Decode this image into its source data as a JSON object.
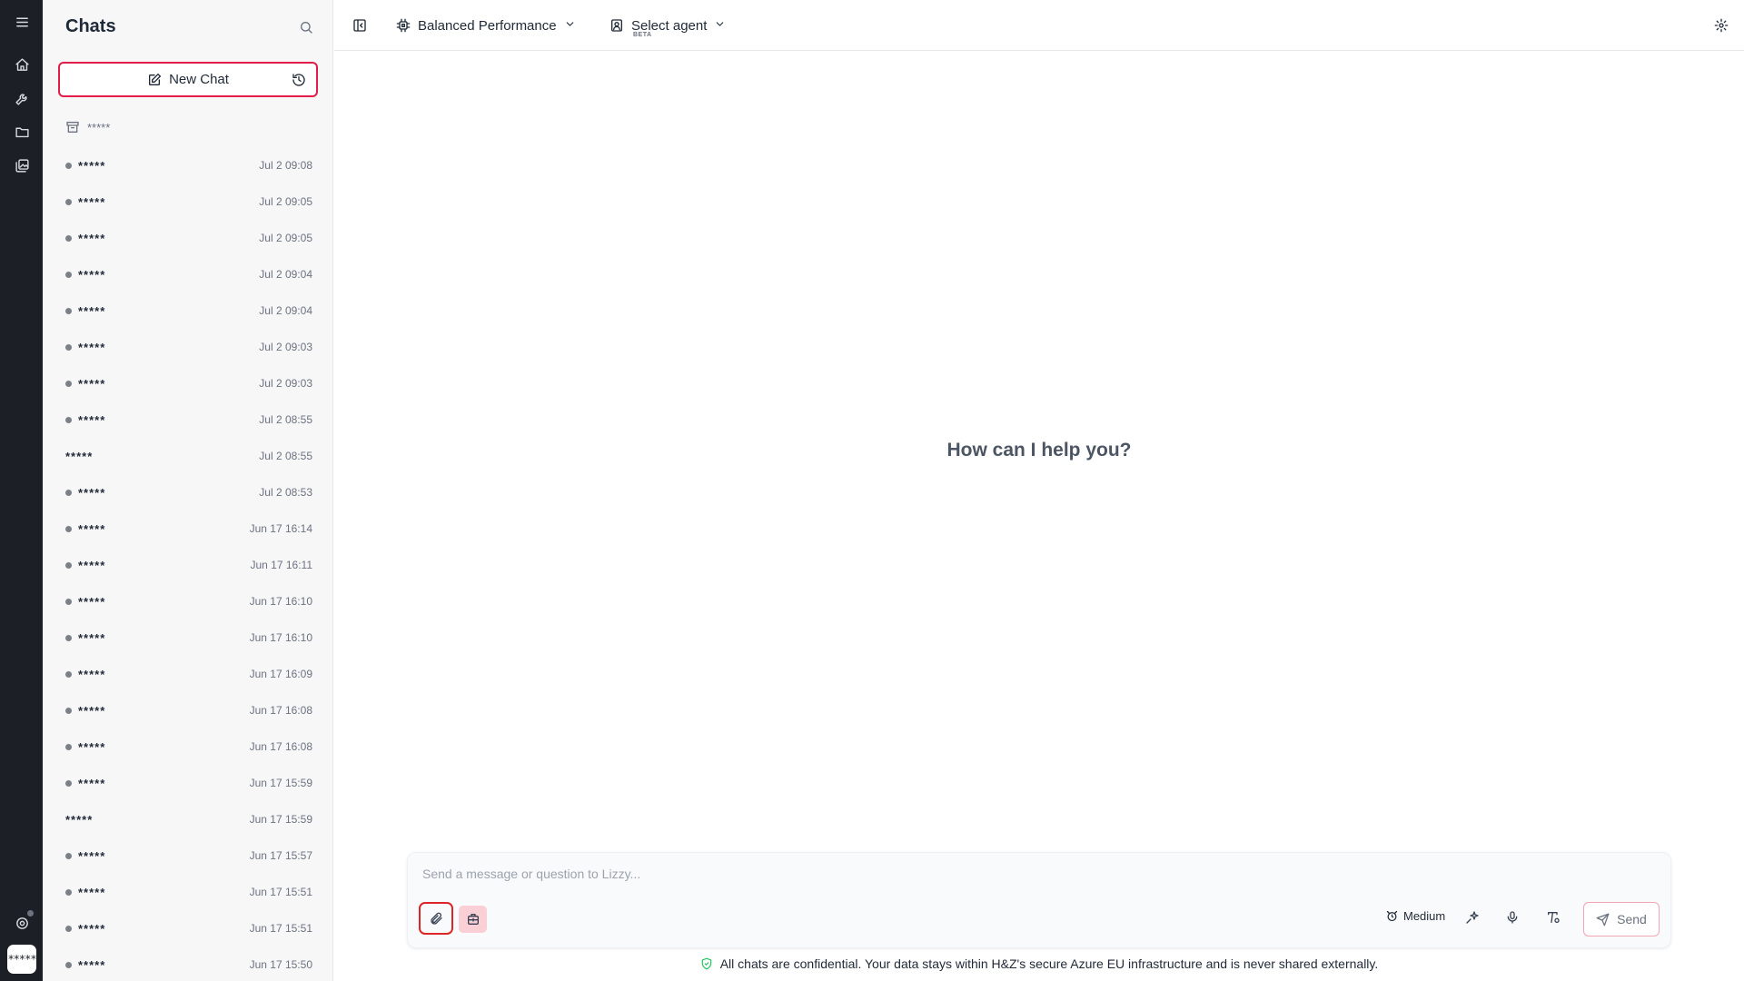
{
  "sidebar": {
    "title": "Chats",
    "new_chat_label": "New Chat",
    "archive_label": "*****",
    "chats": [
      {
        "name": "*****",
        "time": "Jul 2 09:08",
        "dot": true
      },
      {
        "name": "*****",
        "time": "Jul 2 09:05",
        "dot": true
      },
      {
        "name": "*****",
        "time": "Jul 2 09:05",
        "dot": true
      },
      {
        "name": "*****",
        "time": "Jul 2 09:04",
        "dot": true
      },
      {
        "name": "*****",
        "time": "Jul 2 09:04",
        "dot": true
      },
      {
        "name": "*****",
        "time": "Jul 2 09:03",
        "dot": true
      },
      {
        "name": "*****",
        "time": "Jul 2 09:03",
        "dot": true
      },
      {
        "name": "*****",
        "time": "Jul 2 08:55",
        "dot": true
      },
      {
        "name": "*****",
        "time": "Jul 2 08:55",
        "dot": false
      },
      {
        "name": "*****",
        "time": "Jul 2 08:53",
        "dot": true
      },
      {
        "name": "*****",
        "time": "Jun 17 16:14",
        "dot": true
      },
      {
        "name": "*****",
        "time": "Jun 17 16:11",
        "dot": true
      },
      {
        "name": "*****",
        "time": "Jun 17 16:10",
        "dot": true
      },
      {
        "name": "*****",
        "time": "Jun 17 16:10",
        "dot": true
      },
      {
        "name": "*****",
        "time": "Jun 17 16:09",
        "dot": true
      },
      {
        "name": "*****",
        "time": "Jun 17 16:08",
        "dot": true
      },
      {
        "name": "*****",
        "time": "Jun 17 16:08",
        "dot": true
      },
      {
        "name": "*****",
        "time": "Jun 17 15:59",
        "dot": true
      },
      {
        "name": "*****",
        "time": "Jun 17 15:59",
        "dot": false
      },
      {
        "name": "*****",
        "time": "Jun 17 15:57",
        "dot": true
      },
      {
        "name": "*****",
        "time": "Jun 17 15:51",
        "dot": true
      },
      {
        "name": "*****",
        "time": "Jun 17 15:51",
        "dot": true
      },
      {
        "name": "*****",
        "time": "Jun 17 15:50",
        "dot": true
      }
    ]
  },
  "rail": {
    "items": [
      "menu-icon",
      "home-icon",
      "wrench-icon",
      "folder-icon",
      "gallery-icon"
    ],
    "avatar_text": "*****"
  },
  "topbar": {
    "model_label": "Balanced Performance",
    "agent_label": "Select agent",
    "agent_badge": "BETA"
  },
  "main": {
    "welcome": "How can I help you?"
  },
  "composer": {
    "placeholder": "Send a message or question to Lizzy...",
    "value": "",
    "mode_label": "Medium",
    "send_label": "Send"
  },
  "footer": {
    "note": "All chats are confidential. Your data stays within H&Z's secure Azure EU infrastructure and is never shared externally."
  },
  "colors": {
    "accent": "#e11d48",
    "rail_bg": "#1c1f26",
    "sidebar_bg": "#f7f7f8",
    "shield": "#22c55e"
  }
}
